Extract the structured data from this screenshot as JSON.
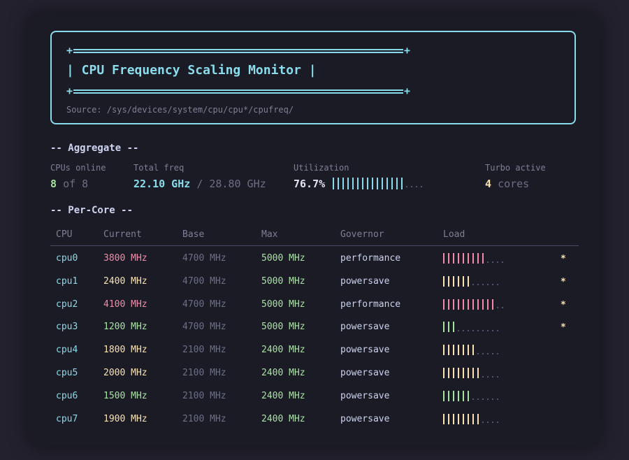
{
  "header": {
    "title": "| CPU Frequency Scaling Monitor |",
    "rule_left": "+",
    "rule_right": "+",
    "source": "Source: /sys/devices/system/cpu/cpu*/cpufreq/"
  },
  "aggregate": {
    "section_title": "-- Aggregate --",
    "cpus_online_label": "CPUs online",
    "cpus_online_value": "8",
    "cpus_online_total": "of 8",
    "total_freq_label": "Total freq",
    "total_freq_value": "22.10 GHz",
    "total_freq_max": "/ 28.80 GHz",
    "utilization_label": "Utilization",
    "utilization_value": "76.7%",
    "utilization_fraction": 0.767,
    "turbo_label": "Turbo active",
    "turbo_value": "4",
    "turbo_unit": "cores"
  },
  "per_core": {
    "section_title": "-- Per-Core --",
    "columns": [
      "CPU",
      "Current",
      "Base",
      "Max",
      "Governor",
      "Load"
    ],
    "rows": [
      {
        "cpu": "cpu0",
        "current": "3800",
        "base": "4700 MHz",
        "max": "5000 MHz",
        "governor": "performance",
        "load_ticks": 9,
        "load_dots": 4,
        "level": "hot",
        "turbo": "*"
      },
      {
        "cpu": "cpu1",
        "current": "2400",
        "base": "4700 MHz",
        "max": "5000 MHz",
        "governor": "powersave",
        "load_ticks": 6,
        "load_dots": 6,
        "level": "warm",
        "turbo": "*"
      },
      {
        "cpu": "cpu2",
        "current": "4100",
        "base": "4700 MHz",
        "max": "5000 MHz",
        "governor": "performance",
        "load_ticks": 11,
        "load_dots": 2,
        "level": "hot",
        "turbo": "*"
      },
      {
        "cpu": "cpu3",
        "current": "1200",
        "base": "4700 MHz",
        "max": "5000 MHz",
        "governor": "powersave",
        "load_ticks": 3,
        "load_dots": 9,
        "level": "cool",
        "turbo": "*"
      },
      {
        "cpu": "cpu4",
        "current": "1800",
        "base": "2100 MHz",
        "max": "2400 MHz",
        "governor": "powersave",
        "load_ticks": 7,
        "load_dots": 5,
        "level": "warm",
        "turbo": ""
      },
      {
        "cpu": "cpu5",
        "current": "2000",
        "base": "2100 MHz",
        "max": "2400 MHz",
        "governor": "powersave",
        "load_ticks": 8,
        "load_dots": 4,
        "level": "warm",
        "turbo": ""
      },
      {
        "cpu": "cpu6",
        "current": "1500",
        "base": "2100 MHz",
        "max": "2400 MHz",
        "governor": "powersave",
        "load_ticks": 6,
        "load_dots": 6,
        "level": "cool",
        "turbo": ""
      },
      {
        "cpu": "cpu7",
        "current": "1900",
        "base": "2100 MHz",
        "max": "2400 MHz",
        "governor": "powersave",
        "load_ticks": 8,
        "load_dots": 4,
        "level": "warm",
        "turbo": ""
      }
    ],
    "unit": "MHz"
  },
  "colors": {
    "accent": "#89dceb",
    "hot": "#f38ba8",
    "warm": "#f9e2af",
    "cool": "#a6e3a1",
    "muted": "#7d8094"
  }
}
